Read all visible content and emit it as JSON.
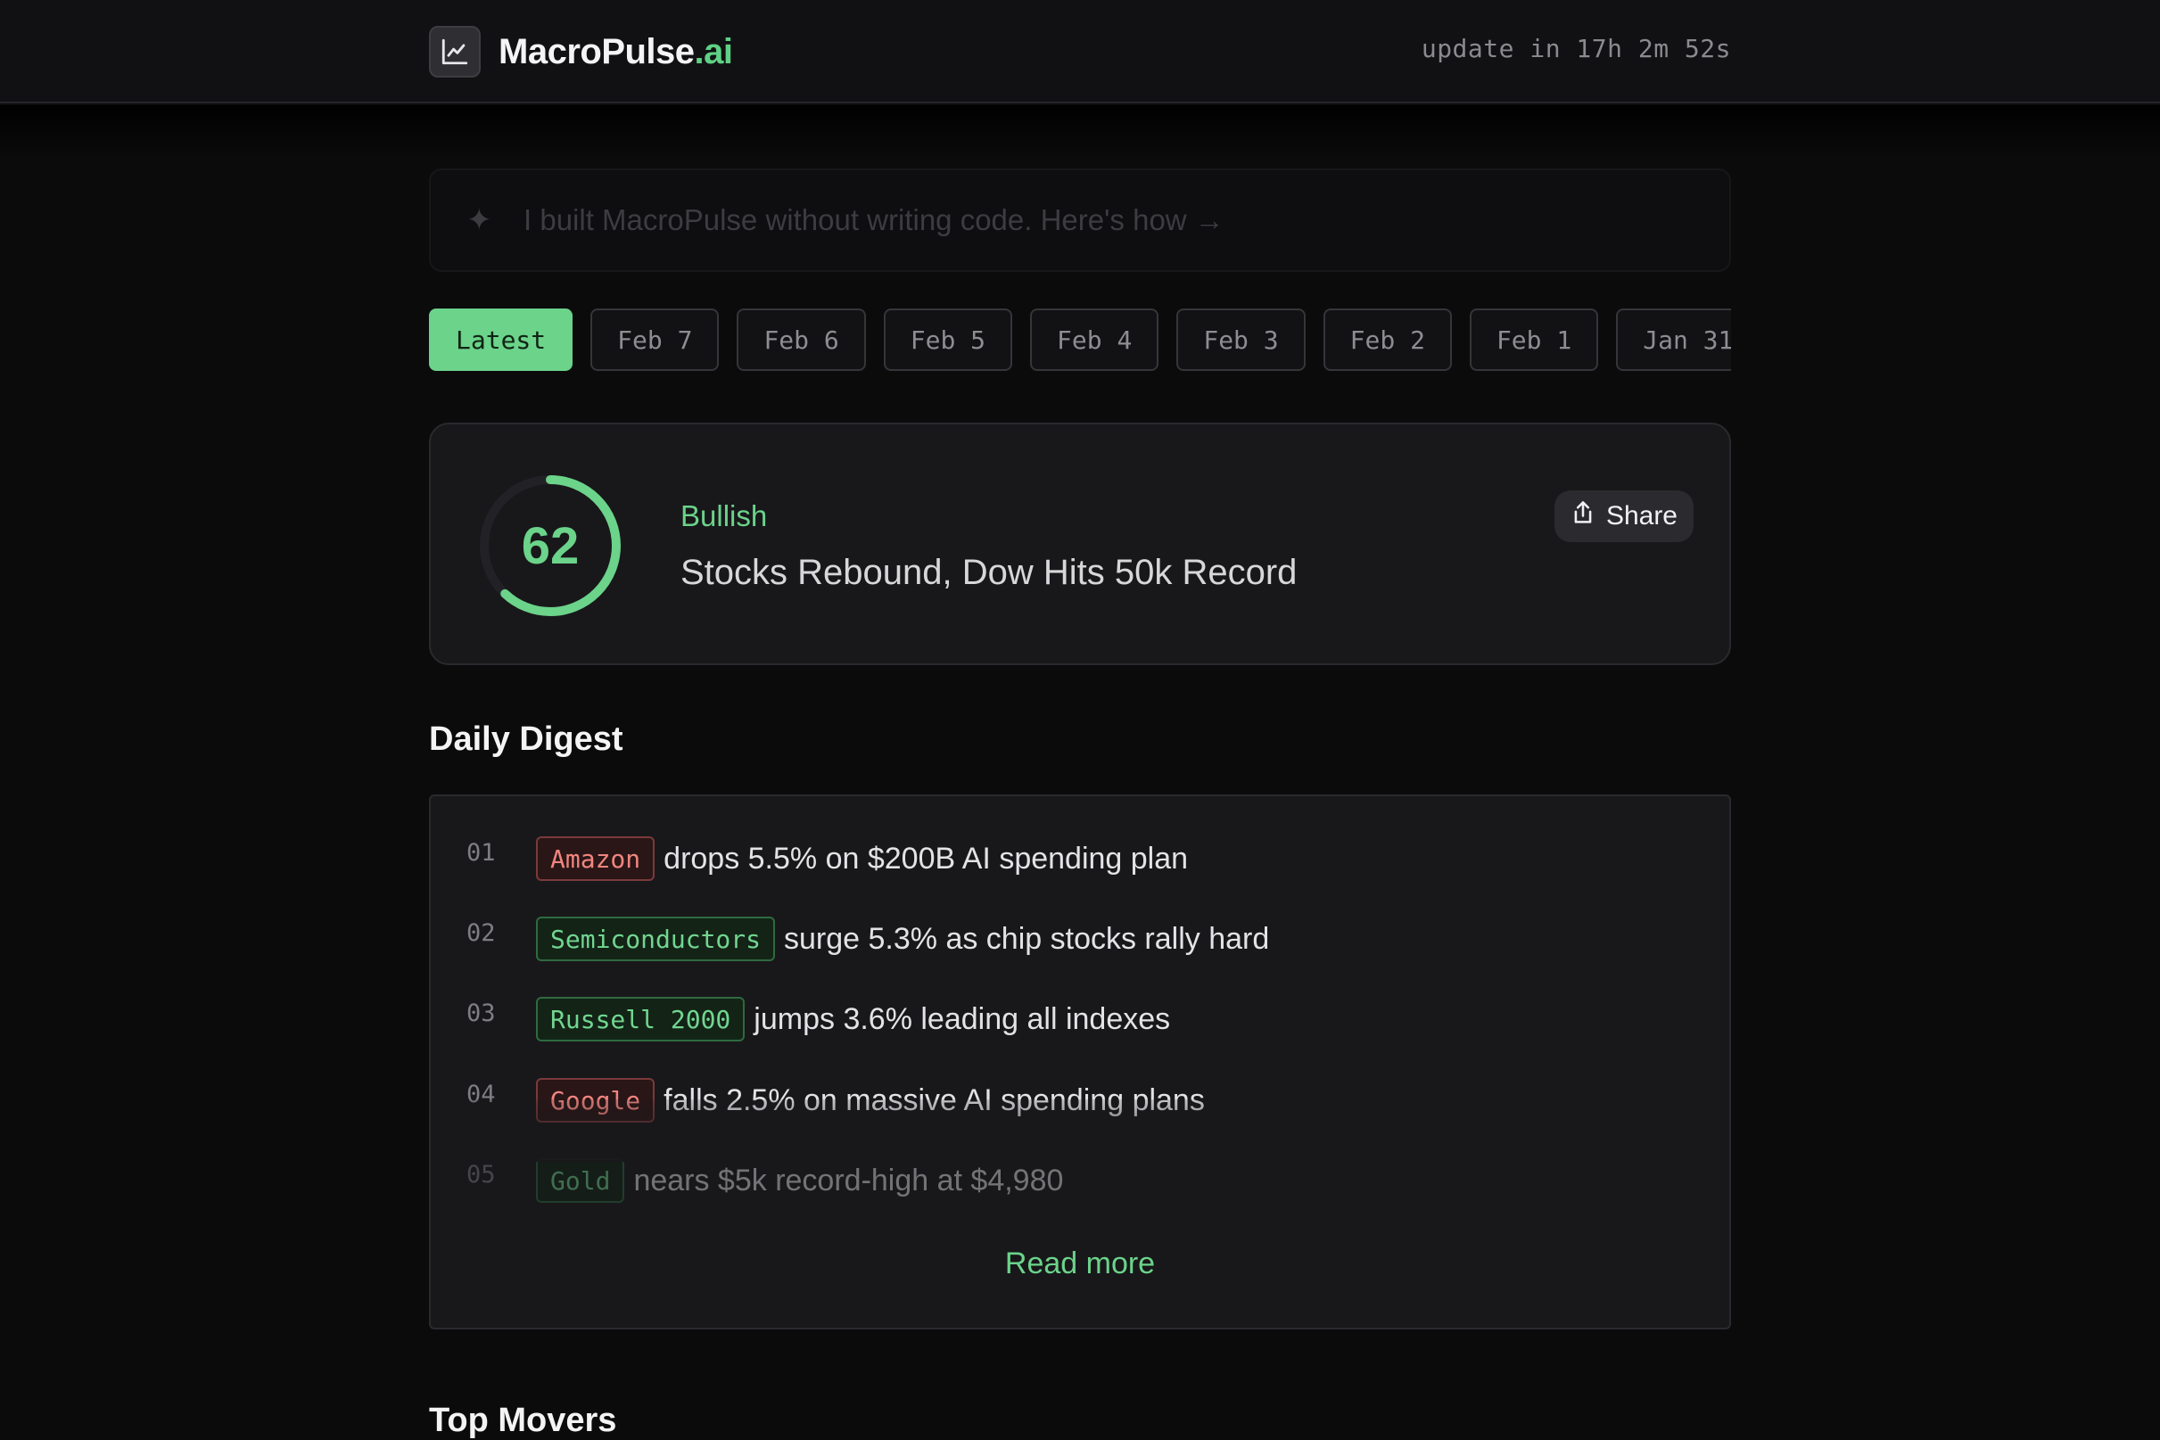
{
  "header": {
    "brand_name": "MacroPulse",
    "brand_tld": ".ai",
    "logo_icon": "line-chart-icon",
    "countdown": "update in 17h 2m 52s"
  },
  "banner": {
    "icon": "sparkle-icon",
    "text": "I built MacroPulse without writing code. Here's how →"
  },
  "date_tabs": [
    {
      "label": "Latest",
      "active": true
    },
    {
      "label": "Feb 7",
      "active": false
    },
    {
      "label": "Feb 6",
      "active": false
    },
    {
      "label": "Feb 5",
      "active": false
    },
    {
      "label": "Feb 4",
      "active": false
    },
    {
      "label": "Feb 3",
      "active": false
    },
    {
      "label": "Feb 2",
      "active": false
    },
    {
      "label": "Feb 1",
      "active": false
    },
    {
      "label": "Jan 31",
      "active": false
    }
  ],
  "sentiment": {
    "score": "62",
    "gauge_fraction": 0.62,
    "label": "Bullish",
    "headline": "Stocks Rebound, Dow Hits 50k Record",
    "share_label": "Share",
    "share_icon": "share-upload-icon"
  },
  "digest": {
    "title": "Daily Digest",
    "items": [
      {
        "num": "01",
        "tag": "Amazon",
        "tone": "neg",
        "text": "drops 5.5% on $200B AI spending plan"
      },
      {
        "num": "02",
        "tag": "Semiconductors",
        "tone": "pos",
        "text": "surge 5.3% as chip stocks rally hard"
      },
      {
        "num": "03",
        "tag": "Russell 2000",
        "tone": "pos",
        "text": "jumps 3.6% leading all indexes"
      },
      {
        "num": "04",
        "tag": "Google",
        "tone": "neg",
        "text": "falls 2.5% on massive AI spending plans"
      },
      {
        "num": "05",
        "tag": "Gold",
        "tone": "pos",
        "text": "nears $5k record-high at $4,980"
      }
    ],
    "read_more": "Read more"
  },
  "next_section_title": "Top Movers",
  "colors": {
    "accent_green": "#6bd38a",
    "negative_red": "#f0857f",
    "background": "#0b0b0c",
    "card": "#18181b"
  }
}
